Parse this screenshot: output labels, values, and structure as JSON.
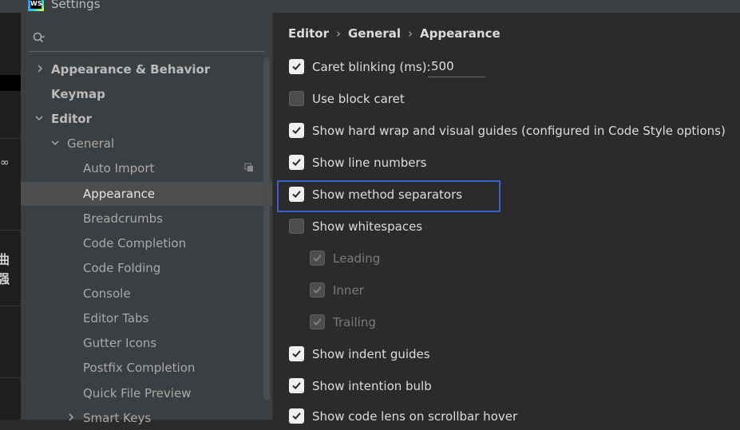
{
  "window": {
    "title": "Settings",
    "logo_text": "WS"
  },
  "background_window": {
    "glyph_top": "∞",
    "glyph_bottom": "曲强"
  },
  "search": {
    "placeholder": ""
  },
  "tree": {
    "items": [
      {
        "label": "Appearance & Behavior",
        "level": 0,
        "expanded": false,
        "bold": true
      },
      {
        "label": "Keymap",
        "level": 0,
        "bold": true
      },
      {
        "label": "Editor",
        "level": 0,
        "expanded": true,
        "bold": true
      },
      {
        "label": "General",
        "level": 1,
        "expanded": true
      },
      {
        "label": "Auto Import",
        "level": 2
      },
      {
        "label": "Appearance",
        "level": 2,
        "selected": true
      },
      {
        "label": "Breadcrumbs",
        "level": 2
      },
      {
        "label": "Code Completion",
        "level": 2
      },
      {
        "label": "Code Folding",
        "level": 2
      },
      {
        "label": "Console",
        "level": 2
      },
      {
        "label": "Editor Tabs",
        "level": 2
      },
      {
        "label": "Gutter Icons",
        "level": 2
      },
      {
        "label": "Postfix Completion",
        "level": 2
      },
      {
        "label": "Quick File Preview",
        "level": 2
      },
      {
        "label": "Smart Keys",
        "level": 2,
        "expanded": false
      }
    ]
  },
  "breadcrumb": {
    "items": [
      "Editor",
      "General",
      "Appearance"
    ],
    "separator": "›"
  },
  "options": {
    "caret_blinking": {
      "label": "Caret blinking (ms):",
      "checked": true,
      "value": "500"
    },
    "block_caret": {
      "label": "Use block caret",
      "checked": false
    },
    "hard_wrap": {
      "label": "Show hard wrap and visual guides (configured in Code Style options)",
      "checked": true
    },
    "line_numbers": {
      "label": "Show line numbers",
      "checked": true
    },
    "method_separators": {
      "label": "Show method separators",
      "checked": true
    },
    "whitespaces": {
      "label": "Show whitespaces",
      "checked": false
    },
    "leading": {
      "label": "Leading",
      "checked": true,
      "disabled": true
    },
    "inner": {
      "label": "Inner",
      "checked": true,
      "disabled": true
    },
    "trailing": {
      "label": "Trailing",
      "checked": true,
      "disabled": true
    },
    "indent_guides": {
      "label": "Show indent guides",
      "checked": true
    },
    "intention_bulb": {
      "label": "Show intention bulb",
      "checked": true
    },
    "code_lens": {
      "label": "Show code lens on scrollbar hover",
      "checked": true
    }
  },
  "colors": {
    "accent_focus": "#3b5fcf",
    "sidebar_bg": "#3c3f41",
    "main_bg": "#2b2b2b",
    "selection_bg": "#4b4d4f"
  }
}
